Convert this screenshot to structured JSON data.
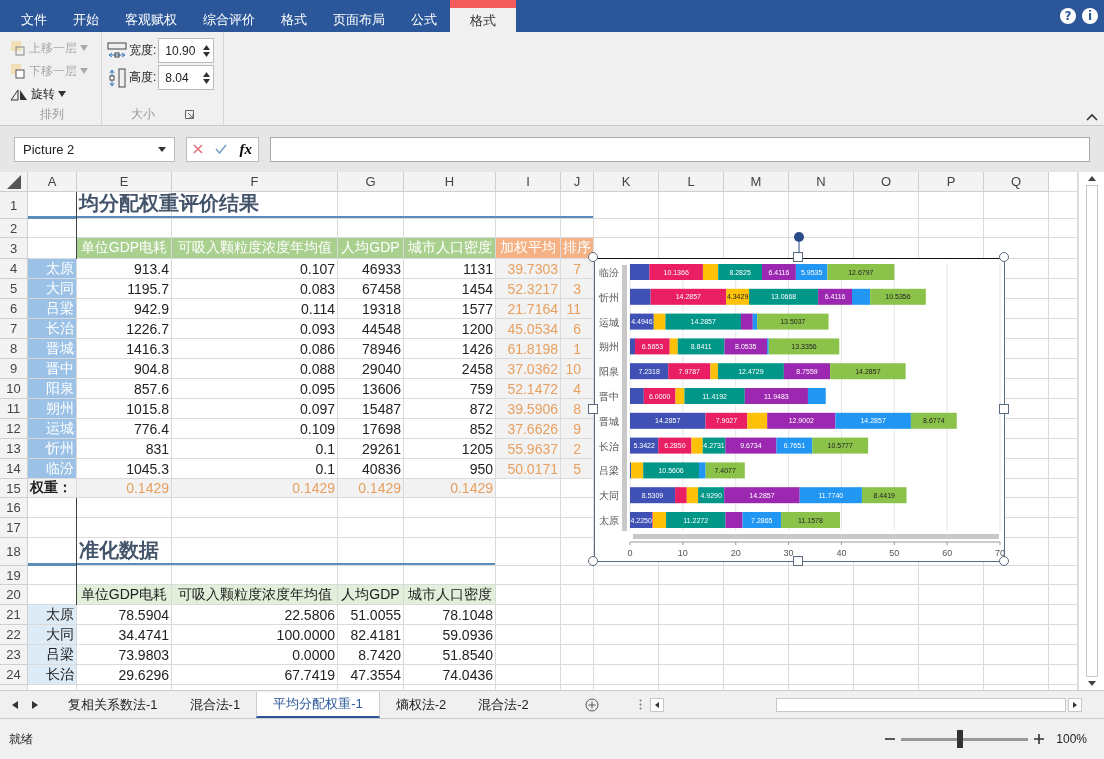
{
  "menu_tabs": [
    {
      "label": "文件",
      "selected": false,
      "contextual": false
    },
    {
      "label": "开始",
      "selected": false,
      "contextual": false
    },
    {
      "label": "客观赋权",
      "selected": false,
      "contextual": false
    },
    {
      "label": "综合评价",
      "selected": false,
      "contextual": false
    },
    {
      "label": "格式",
      "selected": false,
      "contextual": false
    },
    {
      "label": "页面布局",
      "selected": false,
      "contextual": false
    },
    {
      "label": "公式",
      "selected": false,
      "contextual": false
    },
    {
      "label": "格式",
      "selected": true,
      "contextual": true
    }
  ],
  "window_buttons": [
    "?",
    "i"
  ],
  "ribbon": {
    "groups": [
      {
        "kind": "arrange",
        "title": "排列",
        "items": [
          {
            "kind": "bring_forward",
            "label": "上移一层",
            "disabled": true
          },
          {
            "kind": "send_backward",
            "label": "下移一层",
            "disabled": true
          },
          {
            "kind": "rotate",
            "label": "旋转",
            "disabled": false
          }
        ]
      },
      {
        "kind": "size",
        "title": "大小",
        "fields": [
          {
            "kind": "width",
            "label": "宽度:",
            "value": "10.90"
          },
          {
            "kind": "height",
            "label": "高度:",
            "value": "8.04"
          }
        ]
      }
    ]
  },
  "formula_bar": {
    "name_box": "Picture 2",
    "function_label": "fx"
  },
  "sheet": {
    "columns": [
      "A",
      "E",
      "F",
      "G",
      "H",
      "I",
      "J",
      "K",
      "L",
      "M",
      "N",
      "O",
      "P",
      "Q"
    ],
    "row_numbers": [
      "1",
      "2",
      "3",
      "4",
      "5",
      "6",
      "7",
      "8",
      "9",
      "10",
      "11",
      "12",
      "13",
      "14",
      "15",
      "16",
      "17",
      "18",
      "19",
      "20",
      "21",
      "22",
      "23",
      "24"
    ],
    "result_table": {
      "title": "均分配权重评价结果",
      "headers": [
        "单位GDP电耗",
        "可吸入颗粒度浓度年均值",
        "人均GDP",
        "城市人口密度"
      ],
      "extra_headers": [
        "加权平均",
        "排序"
      ],
      "rows": [
        {
          "city": "太原",
          "values": [
            "913.4",
            "0.107",
            "46933",
            "1131"
          ],
          "score": "39.7303",
          "rank": "7"
        },
        {
          "city": "大同",
          "values": [
            "1195.7",
            "0.083",
            "67458",
            "1454"
          ],
          "score": "52.3217",
          "rank": "3"
        },
        {
          "city": "吕梁",
          "values": [
            "942.9",
            "0.114",
            "19318",
            "1577"
          ],
          "score": "21.7164",
          "rank": "11"
        },
        {
          "city": "长治",
          "values": [
            "1226.7",
            "0.093",
            "44548",
            "1200"
          ],
          "score": "45.0534",
          "rank": "6"
        },
        {
          "city": "晋城",
          "values": [
            "1416.3",
            "0.086",
            "78946",
            "1426"
          ],
          "score": "61.8198",
          "rank": "1"
        },
        {
          "city": "晋中",
          "values": [
            "904.8",
            "0.088",
            "29040",
            "2458"
          ],
          "score": "37.0362",
          "rank": "10"
        },
        {
          "city": "阳泉",
          "values": [
            "857.6",
            "0.095",
            "13606",
            "759"
          ],
          "score": "52.1472",
          "rank": "4"
        },
        {
          "city": "朔州",
          "values": [
            "1015.8",
            "0.097",
            "15487",
            "872"
          ],
          "score": "39.5906",
          "rank": "8"
        },
        {
          "city": "运城",
          "values": [
            "776.4",
            "0.109",
            "17698",
            "852"
          ],
          "score": "37.6626",
          "rank": "9"
        },
        {
          "city": "忻州",
          "values": [
            "831",
            "0.1",
            "29261",
            "1205"
          ],
          "score": "55.9637",
          "rank": "2"
        },
        {
          "city": "临汾",
          "values": [
            "1045.3",
            "0.1",
            "40836",
            "950"
          ],
          "score": "50.0171",
          "rank": "5"
        }
      ],
      "weight_label": "权重：",
      "weights": [
        "0.1429",
        "0.1429",
        "0.1429",
        "0.1429"
      ]
    },
    "normalized_table": {
      "title": "准化数据",
      "headers": [
        "单位GDP电耗",
        "可吸入颗粒度浓度年均值",
        "人均GDP",
        "城市人口密度"
      ],
      "rows": [
        {
          "city": "太原",
          "values": [
            "78.5904",
            "22.5806",
            "51.0055",
            "78.1048"
          ]
        },
        {
          "city": "大同",
          "values": [
            "34.4741",
            "100.0000",
            "82.4181",
            "59.0936"
          ]
        },
        {
          "city": "吕梁",
          "values": [
            "73.9803",
            "0.0000",
            "8.7420",
            "51.8540"
          ]
        },
        {
          "city": "长治",
          "values": [
            "29.6296",
            "67.7419",
            "47.3554",
            "74.0436"
          ]
        }
      ]
    },
    "chart": {
      "chart_data": {
        "type": "bar",
        "orientation": "horizontal",
        "stacked": true,
        "grid": true,
        "xlim": [
          0,
          70
        ],
        "xticks": [
          0,
          10,
          20,
          30,
          40,
          50,
          60,
          70
        ],
        "categories": [
          "临汾",
          "忻州",
          "运城",
          "朔州",
          "阳泉",
          "晋中",
          "晋城",
          "长治",
          "吕梁",
          "大同",
          "太原"
        ],
        "series": [
          {
            "color": "#3f51b5",
            "values": [
              3.6611,
              3.8983,
              4.4946,
              0.95,
              7.2318,
              2.6126,
              14.2857,
              5.3422,
              0.2,
              8.5309,
              4.225
            ]
          },
          {
            "color": "#e91e63",
            "values": [
              10.1366,
              14.2857,
              null,
              6.5653,
              7.9787,
              6.0,
              7.9027,
              6.285,
              0.0,
              2.2117,
              0.1
            ]
          },
          {
            "color": "#ffc107",
            "values": [
              2.8921,
              4.3429,
              2.2107,
              1.5238,
              1.4222,
              1.6857,
              3.7681,
              2.1369,
              2.3,
              2.1485,
              2.5
            ]
          },
          {
            "color": "#009688",
            "values": [
              8.2825,
              13.0668,
              14.2857,
              8.8411,
              12.4729,
              11.4192,
              0.0,
              4.2731,
              10.5606,
              4.929,
              11.2272
            ]
          },
          {
            "color": "#9c27b0",
            "values": [
              6.4116,
              6.4116,
              2.2337,
              8.0535,
              8.7559,
              11.9483,
              12.9002,
              9.6734,
              0.0,
              14.2857,
              3.2338
            ]
          },
          {
            "color": "#2196f3",
            "values": [
              5.9535,
              3.4228,
              0.8342,
              0.3213,
              0.0,
              3.3704,
              14.2857,
              6.7651,
              1.2481,
              11.774,
              7.2865
            ]
          },
          {
            "color": "#8bc34a",
            "values": [
              12.6797,
              10.5356,
              13.5037,
              13.3356,
              14.2857,
              0.0,
              8.6774,
              10.5777,
              7.4077,
              8.4419,
              11.1578
            ]
          }
        ],
        "value_labels": [
          [
            null,
            null,
            "4.4946",
            null,
            "7.2318",
            null,
            "14.2857",
            "5.3422",
            null,
            "8.5309",
            "4.2250"
          ],
          [
            "10.1366",
            "14.2857",
            null,
            "6.5653",
            "7.9787",
            "6.0000",
            "7.9027",
            "6.2850",
            null,
            null,
            null
          ],
          [
            null,
            "4.3429",
            null,
            null,
            null,
            null,
            null,
            null,
            null,
            null,
            null
          ],
          [
            "8.2825",
            "13.0668",
            "14.2857",
            "8.8411",
            "12.4729",
            "11.4192",
            null,
            "4.2731",
            "10.5606",
            "4.9290",
            "11.2272"
          ],
          [
            "6.4116",
            "6.4116",
            null,
            "8.0535",
            "8.7559",
            "11.9483",
            "12.9002",
            "9.6734",
            null,
            "14.2857",
            null
          ],
          [
            "5.9535",
            null,
            null,
            null,
            null,
            null,
            "14.2857",
            "6.7651",
            null,
            "11.7740",
            "7.2865"
          ],
          [
            "12.6797",
            "10.5356",
            "13.5037",
            "13.3356",
            "14.2857",
            null,
            "8.6774",
            "10.5777",
            "7.4077",
            "8.4419",
            "11.1578"
          ]
        ]
      }
    }
  },
  "sheet_tabs": [
    {
      "label": "复相关系数法-1",
      "selected": false
    },
    {
      "label": "混合法-1",
      "selected": false
    },
    {
      "label": "平均分配权重-1",
      "selected": true
    },
    {
      "label": "熵权法-2",
      "selected": false
    },
    {
      "label": "混合法-2",
      "selected": false
    }
  ],
  "status_bar": {
    "text": "就绪",
    "zoom_slider": {
      "level": 0.46
    },
    "zoom": "100%"
  }
}
